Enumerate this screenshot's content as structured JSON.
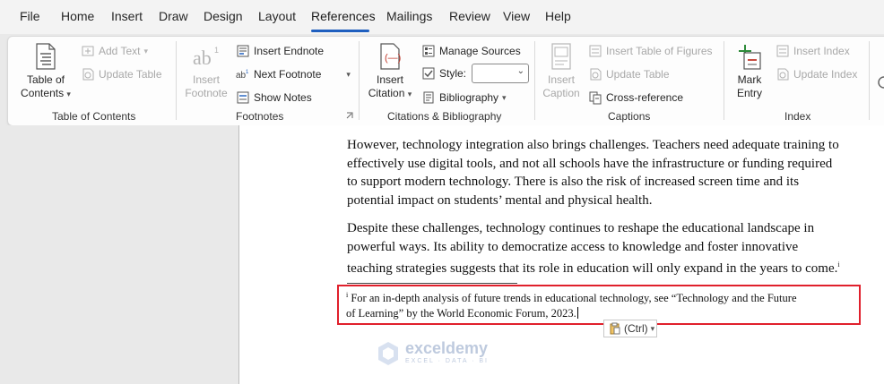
{
  "tabs": [
    "File",
    "Home",
    "Insert",
    "Draw",
    "Design",
    "Layout",
    "References",
    "Mailings",
    "Review",
    "View",
    "Help"
  ],
  "active_tab": "References",
  "ribbon": {
    "toc": {
      "toc_button": [
        "Table of",
        "Contents"
      ],
      "add_text": "Add Text",
      "update_table": "Update Table",
      "label": "Table of Contents"
    },
    "footnotes": {
      "insert_footnote": [
        "Insert",
        "Footnote"
      ],
      "insert_endnote": "Insert Endnote",
      "next_footnote": "Next Footnote",
      "show_notes": "Show Notes",
      "label": "Footnotes"
    },
    "citations": {
      "insert_citation": [
        "Insert",
        "Citation"
      ],
      "manage_sources": "Manage Sources",
      "style_label": "Style:",
      "style_value": "",
      "bibliography": "Bibliography",
      "label": "Citations & Bibliography"
    },
    "captions": {
      "insert_caption": [
        "Insert",
        "Caption"
      ],
      "insert_table_of_figures": "Insert Table of Figures",
      "update_table": "Update Table",
      "cross_reference": "Cross-reference",
      "label": "Captions"
    },
    "index": {
      "mark_entry": [
        "Mark",
        "Entry"
      ],
      "insert_index": "Insert Index",
      "update_index": "Update Index",
      "label": "Index"
    }
  },
  "document": {
    "paragraph1": [
      "However, technology integration also brings challenges. Teachers need adequate training to",
      "effectively use digital tools, and not all schools have the infrastructure or funding required",
      "to support modern technology. There is also the risk of increased screen time and its",
      "potential impact on students’ mental and physical health."
    ],
    "paragraph2": [
      "Despite these challenges, technology continues to reshape the educational landscape in",
      "powerful ways. Its ability to democratize access to knowledge and foster innovative",
      "teaching strategies suggests that its role in education will only expand in the years to come."
    ],
    "footnote_ref_mark": "i",
    "footnote_mark": "i",
    "footnote": [
      "For an in-depth analysis of future trends in educational technology, see “Technology and the Future",
      "of Learning” by the World Economic Forum, 2023."
    ]
  },
  "paste_options": "(Ctrl)",
  "watermark": {
    "name": "exceldemy",
    "tagline": "EXCEL · DATA · BI"
  },
  "colors": {
    "accent": "#1f5fbf",
    "highlight_box": "#e0202c"
  }
}
